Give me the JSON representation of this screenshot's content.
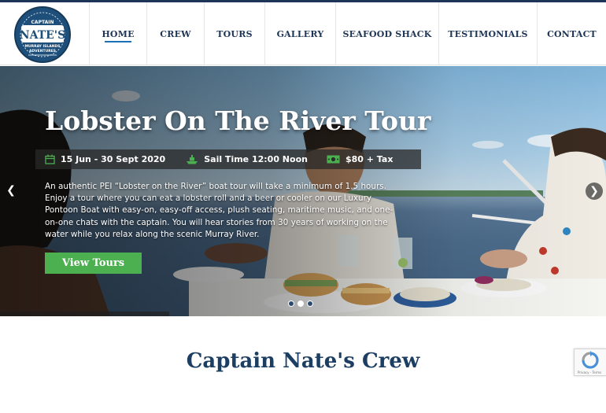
{
  "logo": {
    "text_top": "CAPTAIN",
    "text_main": "NATE'S",
    "text_sub1": "MURRAY ISLANDS",
    "text_sub2": "ADVENTURES"
  },
  "nav": {
    "items": [
      {
        "label": "HOME",
        "active": true
      },
      {
        "label": "CREW"
      },
      {
        "label": "TOURS"
      },
      {
        "label": "GALLERY"
      },
      {
        "label": "SEAFOOD SHACK"
      },
      {
        "label": "TESTIMONIALS"
      },
      {
        "label": "CONTACT"
      }
    ]
  },
  "hero": {
    "title": "Lobster On The River Tour",
    "dates": "15 Jun - 30 Sept 2020",
    "sail_time": "Sail Time 12:00 Noon",
    "price": "$80 + Tax",
    "description": "An authentic PEI “Lobster on the River” boat tour will take a minimum of 1.5 hours. Enjoy a tour where you can eat a lobster roll and a beer or cooler on our Luxury Pontoon Boat with easy-on, easy-off access, plush seating, maritime music, and one-on-one chats with the captain. You will hear stories from 30 years of working on the water while you relax along the scenic Murray River.",
    "cta_label": "View Tours",
    "prev_glyph": "❮",
    "next_glyph": "❯",
    "slide_count": 3,
    "active_slide": 2
  },
  "crew_section": {
    "title": "Captain Nate's Crew"
  },
  "recaptcha": {
    "footer": "Privacy - Terms"
  },
  "colors": {
    "navy": "#1d3557",
    "accent_green": "#4caf50",
    "nav_underline": "#1d6fb8",
    "heading_blue": "#1d3e63"
  }
}
